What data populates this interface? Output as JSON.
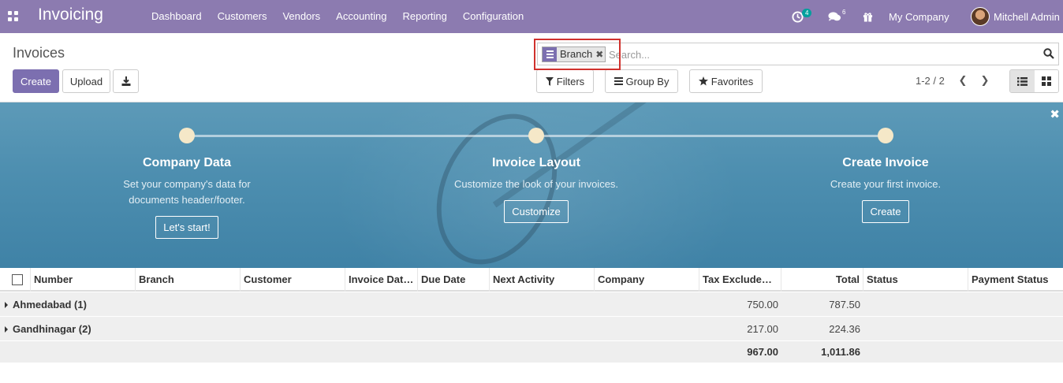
{
  "app": {
    "title": "Invoicing",
    "apps_icon": "grid-icon"
  },
  "menu": [
    "Dashboard",
    "Customers",
    "Vendors",
    "Accounting",
    "Reporting",
    "Configuration"
  ],
  "systray": {
    "activity_count": "4",
    "messages_count": "6",
    "company": "My Company",
    "user": "Mitchell Admin"
  },
  "page": {
    "title": "Invoices"
  },
  "buttons": {
    "create": "Create",
    "upload": "Upload"
  },
  "search": {
    "facet": "Branch",
    "placeholder": "Search..."
  },
  "filters": {
    "filters": "Filters",
    "group_by": "Group By",
    "favorites": "Favorites"
  },
  "pager": {
    "text": "1-2 / 2"
  },
  "banner": {
    "steps": [
      {
        "title": "Company Data",
        "desc": "Set your company's data for documents header/footer.",
        "button": "Let's start!"
      },
      {
        "title": "Invoice Layout",
        "desc": "Customize the look of your invoices.",
        "button": "Customize"
      },
      {
        "title": "Create Invoice",
        "desc": "Create your first invoice.",
        "button": "Create"
      }
    ]
  },
  "table": {
    "columns": [
      "Number",
      "Branch",
      "Customer",
      "Invoice Dat…",
      "Due Date",
      "Next Activity",
      "Company",
      "Tax Exclude…",
      "Total",
      "Status",
      "Payment Status"
    ],
    "groups": [
      {
        "name": "Ahmedabad (1)",
        "tax_excluded": "750.00",
        "total": "787.50"
      },
      {
        "name": "Gandhinagar (2)",
        "tax_excluded": "217.00",
        "total": "224.36"
      }
    ],
    "totals": {
      "tax_excluded": "967.00",
      "total": "1,011.86"
    }
  },
  "colors": {
    "navbar": "#8c7bb0",
    "primary": "#7c6fb0",
    "banner": "#4e8fb0",
    "highlight": "#d0312d"
  }
}
